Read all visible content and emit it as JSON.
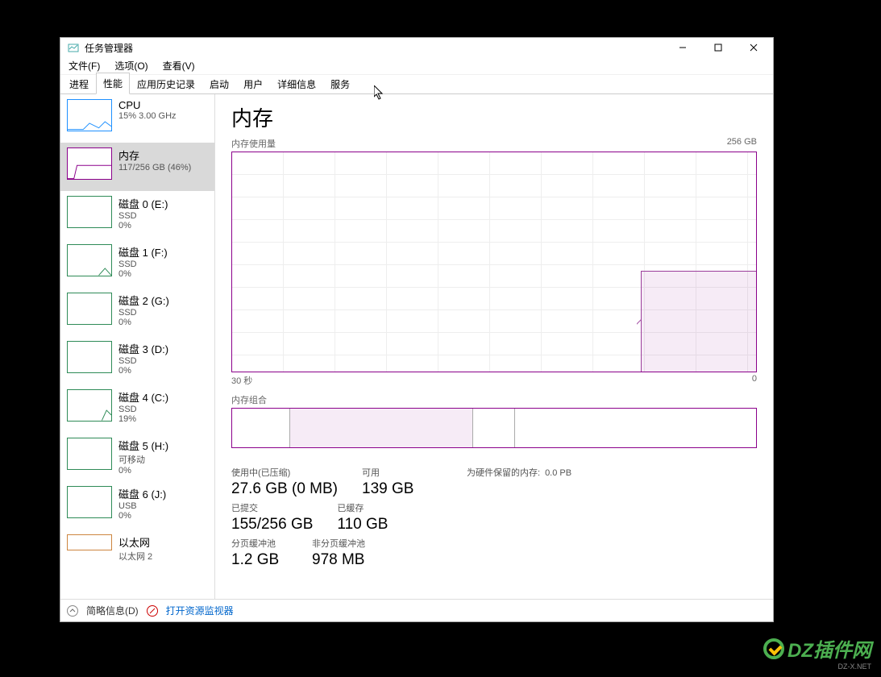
{
  "window": {
    "title": "任务管理器"
  },
  "menubar": {
    "file": "文件(F)",
    "options": "选项(O)",
    "view": "查看(V)"
  },
  "tabs": {
    "processes": "进程",
    "performance": "性能",
    "app_history": "应用历史记录",
    "startup": "启动",
    "users": "用户",
    "details": "详细信息",
    "services": "服务"
  },
  "sidebar": {
    "items": [
      {
        "name": "CPU",
        "sub1": "15% 3.00 GHz",
        "kind": "cpu"
      },
      {
        "name": "内存",
        "sub1": "117/256 GB (46%)",
        "kind": "mem"
      },
      {
        "name": "磁盘 0 (E:)",
        "sub1": "SSD",
        "sub2": "0%",
        "kind": "disk"
      },
      {
        "name": "磁盘 1 (F:)",
        "sub1": "SSD",
        "sub2": "0%",
        "kind": "disk"
      },
      {
        "name": "磁盘 2 (G:)",
        "sub1": "SSD",
        "sub2": "0%",
        "kind": "disk"
      },
      {
        "name": "磁盘 3 (D:)",
        "sub1": "SSD",
        "sub2": "0%",
        "kind": "disk"
      },
      {
        "name": "磁盘 4 (C:)",
        "sub1": "SSD",
        "sub2": "19%",
        "kind": "disk"
      },
      {
        "name": "磁盘 5 (H:)",
        "sub1": "可移动",
        "sub2": "0%",
        "kind": "disk"
      },
      {
        "name": "磁盘 6 (J:)",
        "sub1": "USB",
        "sub2": "0%",
        "kind": "disk"
      },
      {
        "name": "以太网",
        "sub1": "以太网 2",
        "kind": "eth"
      }
    ]
  },
  "main": {
    "title": "内存",
    "usage_label": "内存使用量",
    "max_label": "256 GB",
    "x_left": "30 秒",
    "x_right": "0",
    "composition_label": "内存组合",
    "stats": {
      "in_use_label": "使用中(已压缩)",
      "in_use_value": "27.6 GB (0 MB)",
      "available_label": "可用",
      "available_value": "139 GB",
      "reserved_label": "为硬件保留的内存:",
      "reserved_value": "0.0 PB",
      "committed_label": "已提交",
      "committed_value": "155/256 GB",
      "cached_label": "已缓存",
      "cached_value": "110 GB",
      "paged_label": "分页缓冲池",
      "paged_value": "1.2 GB",
      "nonpaged_label": "非分页缓冲池",
      "nonpaged_value": "978 MB"
    }
  },
  "footer": {
    "fewer": "简略信息(D)",
    "resmon": "打开资源监视器"
  },
  "watermark": {
    "text": "DZ插件网",
    "sub": "DZ-X.NET"
  },
  "chart_data": {
    "type": "area-step-timeseries",
    "title": "内存使用量",
    "xlabel": "秒",
    "ylabel": "GB",
    "x_range_seconds": [
      30,
      0
    ],
    "ylim": [
      0,
      256
    ],
    "approx_percent_used_recent": 46,
    "series": [
      {
        "name": "内存",
        "x_seconds_ago": [
          30,
          25,
          20,
          15,
          10,
          8,
          7,
          6,
          5,
          4,
          3,
          2,
          1,
          0
        ],
        "values_gb": [
          0,
          0,
          0,
          0,
          0,
          0,
          0,
          117,
          117,
          117,
          117,
          117,
          117,
          117
        ]
      }
    ],
    "composition_segments": [
      {
        "name": "other",
        "fraction": 0.11
      },
      {
        "name": "in_use",
        "fraction": 0.35
      },
      {
        "name": "modified",
        "fraction": 0.08
      },
      {
        "name": "standby_free",
        "fraction": 0.46
      }
    ]
  }
}
